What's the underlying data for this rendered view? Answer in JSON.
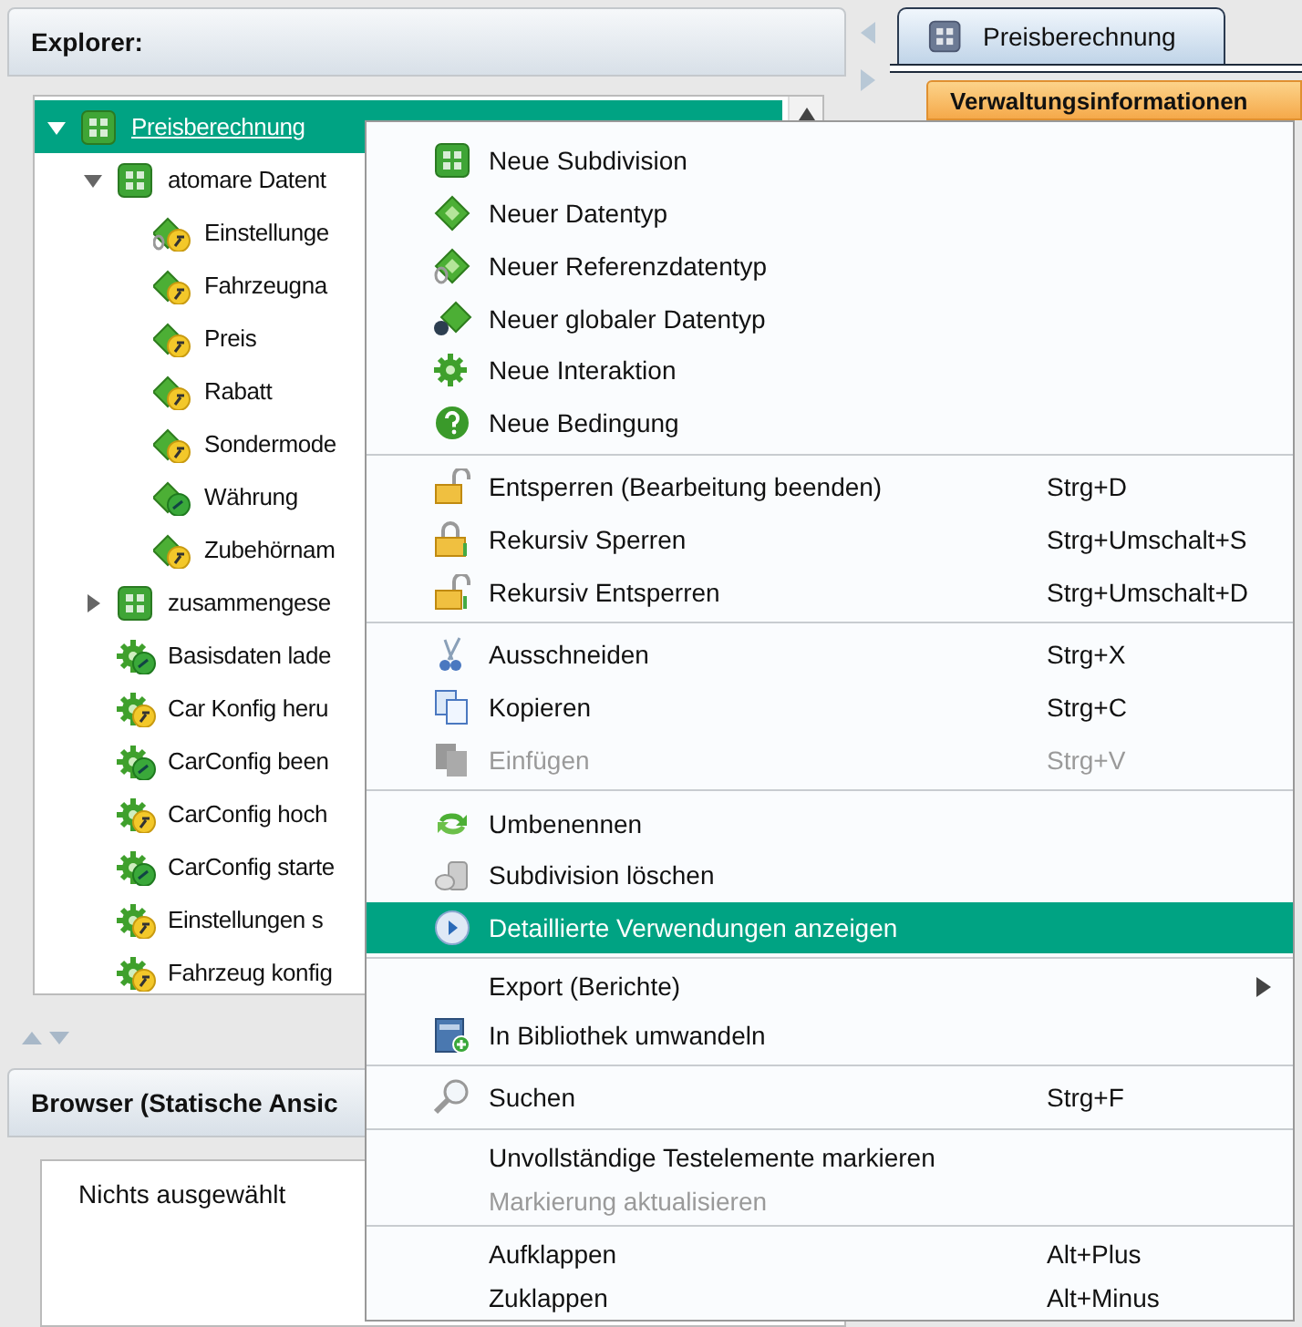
{
  "explorer": {
    "title": "Explorer:",
    "tree": [
      {
        "label": "Preisberechnung",
        "selected": true,
        "expanded": true,
        "children": [
          {
            "label": "atomare Datent",
            "selected": false,
            "expanded": true,
            "children": [
              {
                "label": "Einstellunge",
                "selected": false
              },
              {
                "label": "Fahrzeugna",
                "selected": false
              },
              {
                "label": "Preis",
                "selected": false
              },
              {
                "label": "Rabatt",
                "selected": false
              },
              {
                "label": "Sondermode",
                "selected": false
              },
              {
                "label": "Währung",
                "selected": false
              },
              {
                "label": "Zubehörnam",
                "selected": false
              }
            ]
          },
          {
            "label": "zusammengese",
            "selected": false,
            "expanded": false
          },
          {
            "label": "Basisdaten lade",
            "selected": false
          },
          {
            "label": "Car Konfig heru",
            "selected": false
          },
          {
            "label": "CarConfig been",
            "selected": false
          },
          {
            "label": "CarConfig hoch",
            "selected": false
          },
          {
            "label": "CarConfig starte",
            "selected": false
          },
          {
            "label": "Einstellungen s",
            "selected": false
          },
          {
            "label": "Fahrzeug konfig",
            "selected": false
          }
        ]
      }
    ]
  },
  "browser": {
    "title": "Browser (Statische Ansic",
    "text": "Nichts ausgewählt"
  },
  "editor": {
    "tabs": [
      {
        "label": "Preisberechnung",
        "selected": true
      }
    ],
    "section": "Verwaltungsinformationen"
  },
  "context_menu": [
    {
      "kind": "item",
      "label": "Neue Subdivision",
      "disabled": false,
      "selected": false
    },
    {
      "kind": "item",
      "label": "Neuer Datentyp",
      "disabled": false,
      "selected": false
    },
    {
      "kind": "item",
      "label": "Neuer Referenzdatentyp",
      "disabled": false,
      "selected": false
    },
    {
      "kind": "item",
      "label": "Neuer globaler Datentyp",
      "disabled": false,
      "selected": false
    },
    {
      "kind": "item",
      "label": "Neue Interaktion",
      "disabled": false,
      "selected": false
    },
    {
      "kind": "item",
      "label": "Neue Bedingung",
      "disabled": false,
      "selected": false
    },
    {
      "kind": "separator"
    },
    {
      "kind": "item",
      "label": "Entsperren (Bearbeitung beenden)",
      "shortcut": "Strg+D",
      "disabled": false,
      "selected": false
    },
    {
      "kind": "item",
      "label": "Rekursiv Sperren",
      "shortcut": "Strg+Umschalt+S",
      "disabled": false,
      "selected": false
    },
    {
      "kind": "item",
      "label": "Rekursiv Entsperren",
      "shortcut": "Strg+Umschalt+D",
      "disabled": false,
      "selected": false
    },
    {
      "kind": "separator"
    },
    {
      "kind": "item",
      "label": "Ausschneiden",
      "shortcut": "Strg+X",
      "disabled": false,
      "selected": false
    },
    {
      "kind": "item",
      "label": "Kopieren",
      "shortcut": "Strg+C",
      "disabled": false,
      "selected": false
    },
    {
      "kind": "item",
      "label": "Einfügen",
      "shortcut": "Strg+V",
      "disabled": true,
      "selected": false
    },
    {
      "kind": "separator"
    },
    {
      "kind": "item",
      "label": "Umbenennen",
      "disabled": false,
      "selected": false
    },
    {
      "kind": "item",
      "label": "Subdivision löschen",
      "disabled": false,
      "selected": false
    },
    {
      "kind": "item",
      "label": "Detaillierte Verwendungen anzeigen",
      "disabled": false,
      "selected": true
    },
    {
      "kind": "separator"
    },
    {
      "kind": "submenu",
      "label": "Export (Berichte)",
      "disabled": false,
      "selected": false
    },
    {
      "kind": "item",
      "label": "In Bibliothek umwandeln",
      "disabled": false,
      "selected": false
    },
    {
      "kind": "separator"
    },
    {
      "kind": "item",
      "label": "Suchen",
      "shortcut": "Strg+F",
      "disabled": false,
      "selected": false
    },
    {
      "kind": "separator"
    },
    {
      "kind": "item",
      "label": "Unvollständige Testelemente markieren",
      "disabled": false,
      "selected": false
    },
    {
      "kind": "item",
      "label": "Markierung aktualisieren",
      "disabled": true,
      "selected": false
    },
    {
      "kind": "separator"
    },
    {
      "kind": "item",
      "label": "Aufklappen",
      "shortcut": "Alt+Plus",
      "disabled": false,
      "selected": false
    },
    {
      "kind": "item",
      "label": "Zuklappen",
      "shortcut": "Alt+Minus",
      "disabled": false,
      "selected": false
    }
  ]
}
